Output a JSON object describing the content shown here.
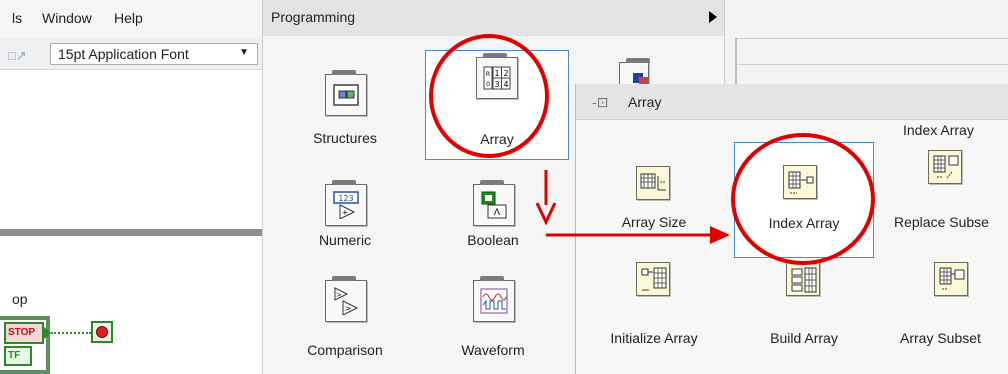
{
  "menubar": {
    "items": [
      "ls",
      "Window",
      "Help"
    ]
  },
  "toolbar": {
    "font_value": "15pt Application Font",
    "dropdown_glyph": "▼"
  },
  "diagram": {
    "loop_label": "op",
    "stop_button_text": "STOP",
    "tf_terminal_text": "TF"
  },
  "programming_palette": {
    "title": "Programming",
    "items": [
      {
        "label": "Structures"
      },
      {
        "label": "Array"
      },
      {
        "label": "Numeric"
      },
      {
        "label": "Boolean"
      },
      {
        "label": "Comparison"
      },
      {
        "label": "Waveform"
      }
    ]
  },
  "array_palette": {
    "title": "Array",
    "tooltip": "Index Array",
    "items": [
      {
        "label": "Array Size"
      },
      {
        "label": "Index Array"
      },
      {
        "label": "Replace Subse"
      },
      {
        "label": "Initialize Array"
      },
      {
        "label": "Build Array"
      },
      {
        "label": "Array Subset"
      }
    ]
  },
  "annotation_color": "#e00000",
  "highlight_color": "#4a8ad4"
}
